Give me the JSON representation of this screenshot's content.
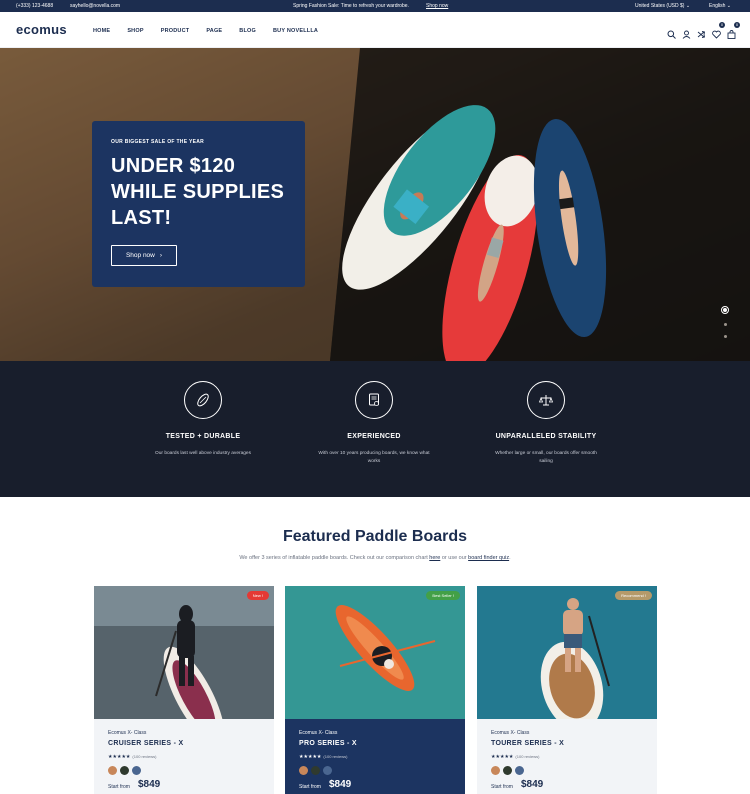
{
  "topbar": {
    "phone": "(+333) 123-4688",
    "email": "sayhello@novella.com",
    "promo_text": "Spring Fashion Sale: Time to refresh your wardrobe.",
    "promo_link": "Shop now",
    "currency": "United States (USD $)",
    "language": "English"
  },
  "header": {
    "logo": "ecomus",
    "nav": [
      "HOME",
      "SHOP",
      "PRODUCT",
      "PAGE",
      "BLOG",
      "BUY NOVELLLA"
    ],
    "wishlist_count": "0",
    "cart_count": "0",
    "icons": [
      "search-icon",
      "user-icon",
      "compare-icon",
      "heart-icon",
      "cart-icon"
    ]
  },
  "hero": {
    "eyebrow": "OUR BIGGEST SALE OF THE YEAR",
    "title_line1": "UNDER $120",
    "title_line2": "WHILE SUPPLIES",
    "title_line3": "LAST!",
    "button": "Shop now",
    "slides": 3,
    "active_slide": 1
  },
  "features": [
    {
      "title": "TESTED + DURABLE",
      "text": "Our boards last well above industry averages",
      "icon": "board-icon"
    },
    {
      "title": "EXPERIENCED",
      "text": "With over 10 years producing boards, we know what works",
      "icon": "certificate-icon"
    },
    {
      "title": "UNPARALLELED STABILITY",
      "text": "Whether large or small, our boards offer smooth sailing",
      "icon": "balance-icon"
    }
  ],
  "featured": {
    "title": "Featured Paddle Boards",
    "sub_before": "We offer 3 series of inflatable paddle boards. Check out our comparison chart",
    "sub_link1": "here",
    "sub_mid": "or use our",
    "sub_link2": "board finder quiz",
    "sub_end": "."
  },
  "products": [
    {
      "tag": "New !",
      "tag_color": "#e53935",
      "class": "Ecomus X- Class",
      "name": "CRUISER SERIES - X",
      "stars": "★★★★★",
      "reviews": "(100 reviews)",
      "price_label": "Start from",
      "price": "$849",
      "swatches": [
        "#c8875a",
        "#2f3a2e",
        "#4a6690"
      ]
    },
    {
      "tag": "Best Seller !",
      "tag_color": "#43a047",
      "class": "Ecomus X- Class",
      "name": "PRO SERIES - X",
      "stars": "★★★★★",
      "reviews": "(100 reviews)",
      "price_label": "Start from",
      "price": "$849",
      "swatches": [
        "#c8875a",
        "#2f3a2e",
        "#4a6690"
      ]
    },
    {
      "tag": "Recommend !",
      "tag_color": "#b59a6a",
      "class": "Ecomus X- Class",
      "name": "TOURER SERIES - X",
      "stars": "★★★★★",
      "reviews": "(100 reviews)",
      "price_label": "Start from",
      "price": "$849",
      "swatches": [
        "#c8875a",
        "#2f3a2e",
        "#4a6690"
      ]
    }
  ]
}
